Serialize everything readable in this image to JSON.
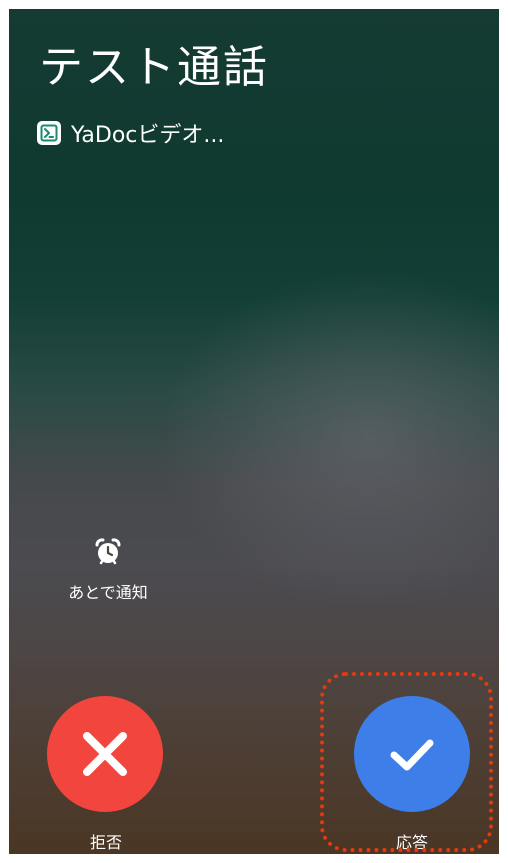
{
  "call": {
    "title": "テスト通話",
    "app_name": "YaDocビデオ...",
    "app_icon": "yadoc-app-icon"
  },
  "remind": {
    "label": "あとで通知",
    "icon": "alarm-clock-icon"
  },
  "actions": {
    "decline_label": "拒否",
    "accept_label": "応答",
    "decline_icon": "close-icon",
    "accept_icon": "checkmark-icon"
  },
  "colors": {
    "decline": "#f2453d",
    "accept": "#3d7ee8",
    "highlight": "#e8380d"
  }
}
